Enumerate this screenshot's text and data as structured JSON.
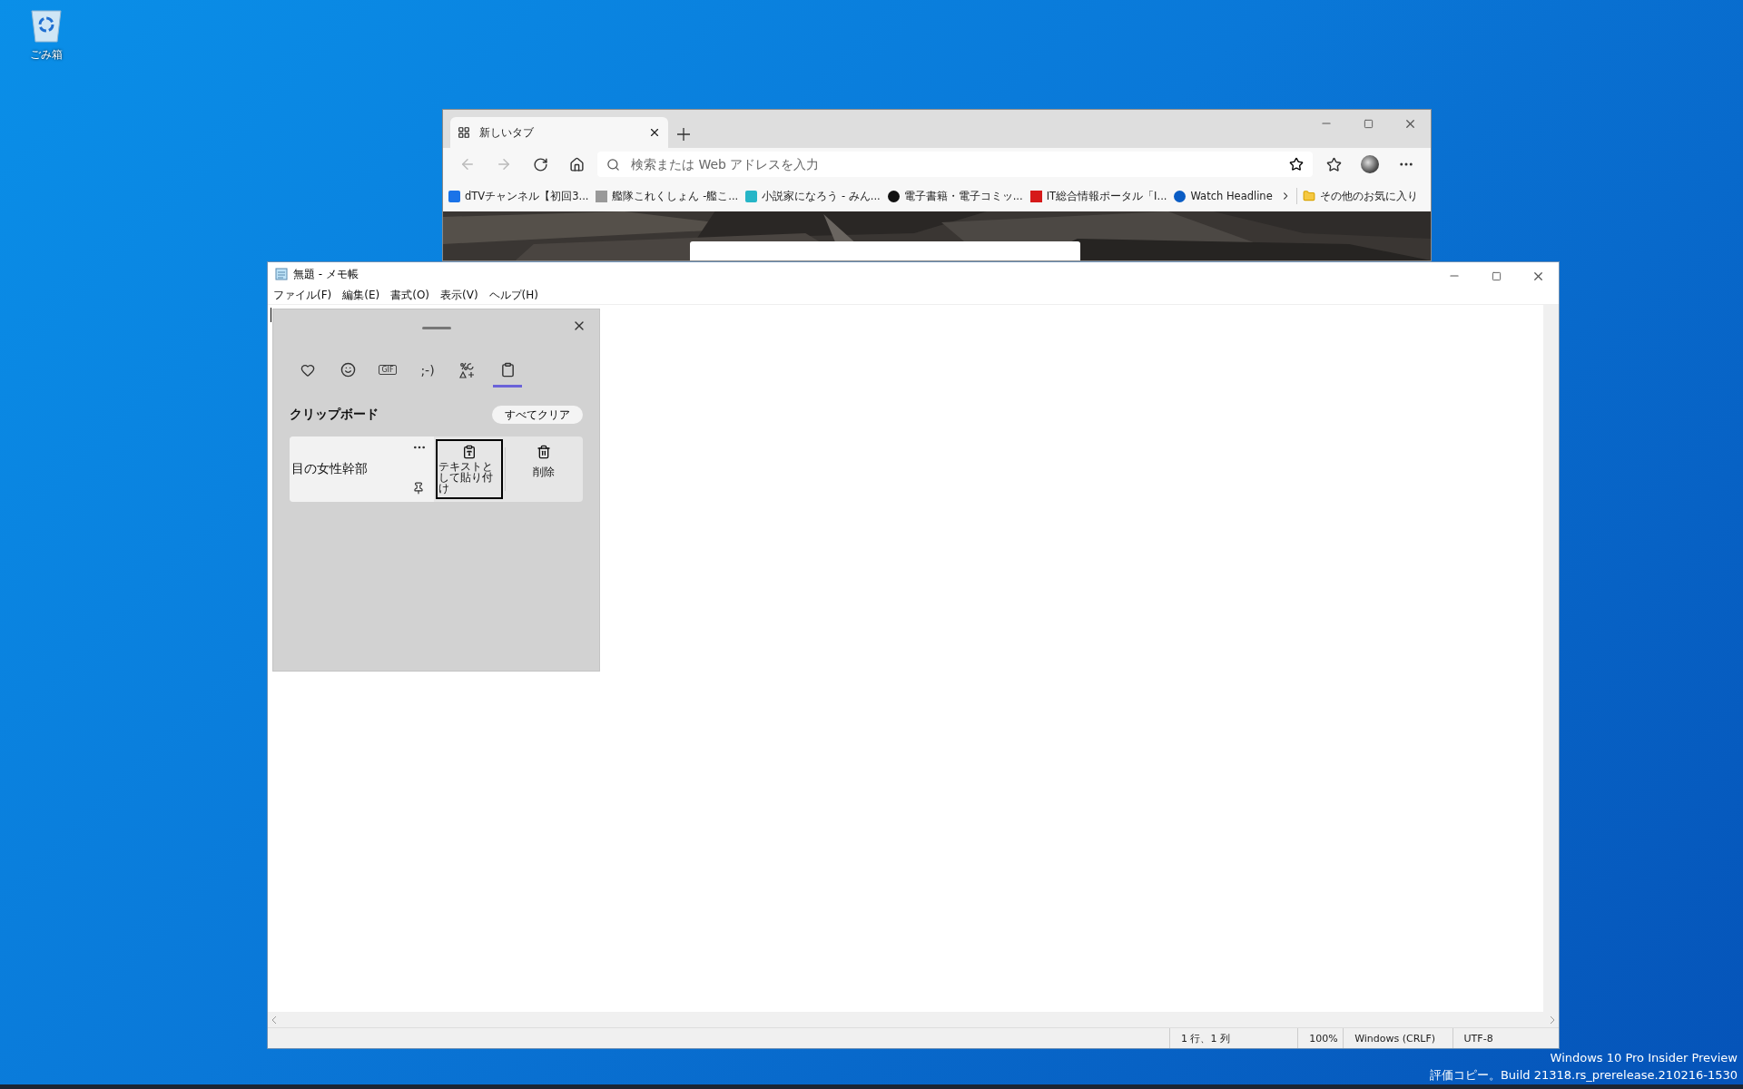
{
  "desktop": {
    "icons": [
      {
        "label": "ごみ箱"
      }
    ],
    "watermark": [
      "Windows 10 Pro Insider Preview",
      "評価コピー。Build 21318.rs_prerelease.210216-1530"
    ]
  },
  "browser": {
    "tabs": [
      {
        "label": "新しいタブ",
        "selected": true
      }
    ],
    "address": {
      "placeholder": "検索または Web アドレスを入力"
    },
    "bookmarks": [
      {
        "kind": "dtv",
        "label": "dTVチャンネル【初回3..."
      },
      {
        "kind": "wiki",
        "label": "艦隊これくしょん -艦こ..."
      },
      {
        "kind": "novel",
        "label": "小説家になろう - みん..."
      },
      {
        "kind": "pen",
        "label": "電子書籍・電子コミッ..."
      },
      {
        "kind": "it",
        "label": "IT総合情報ポータル「I..."
      },
      {
        "kind": "globe",
        "label": "Watch Headline"
      }
    ],
    "other_favorites": "その他のお気に入り"
  },
  "notepad": {
    "title": "無題 - メモ帳",
    "menu": [
      "ファイル(F)",
      "編集(E)",
      "書式(O)",
      "表示(V)",
      "ヘルプ(H)"
    ],
    "status_bar": [
      "1 行、1 列",
      "100%",
      "Windows (CRLF)",
      "UTF-8"
    ]
  },
  "emoji_panel": {
    "tabs": [
      {
        "kind": "favorites",
        "selected": false
      },
      {
        "kind": "emoji",
        "selected": false
      },
      {
        "kind": "gif",
        "label": "GIF",
        "selected": false
      },
      {
        "kind": "kaomoji",
        "label": ";-)",
        "selected": false
      },
      {
        "kind": "symbols",
        "selected": false
      },
      {
        "kind": "clipboard",
        "selected": true
      }
    ],
    "section_title": "クリップボード",
    "clear_all": "すべてクリア",
    "items": [
      {
        "text": "目の女性幹部",
        "actions": [
          {
            "kind": "paste-text",
            "label": "テキストとして貼り付け",
            "focused": true
          },
          {
            "kind": "delete",
            "label": "削除",
            "focused": false
          }
        ]
      }
    ]
  }
}
